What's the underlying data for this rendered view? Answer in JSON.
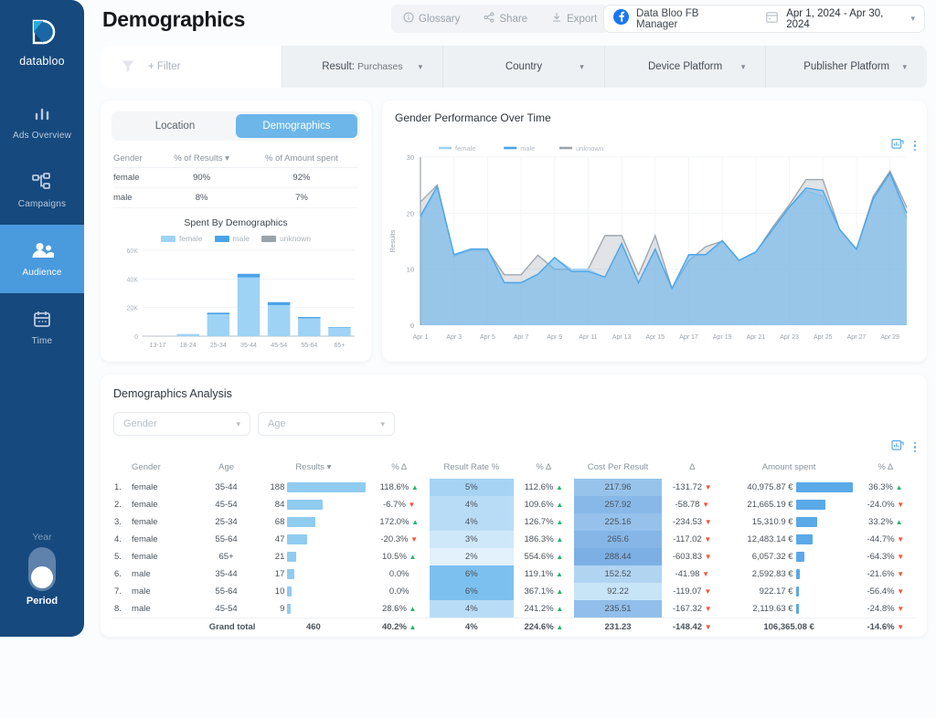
{
  "brand": {
    "name": "databloo",
    "sidebar_bg": "#16497d",
    "active_bg": "#4a9ade",
    "accent": "#5aa9e8"
  },
  "header": {
    "title": "Demographics",
    "tools": [
      {
        "label": "Glossary",
        "icon": "info-icon"
      },
      {
        "label": "Share",
        "icon": "share-icon"
      },
      {
        "label": "Export",
        "icon": "download-icon"
      }
    ],
    "account": "Data Bloo FB Manager",
    "account_icon": "facebook-icon",
    "date_range": "Apr 1, 2024 - Apr 30, 2024",
    "calendar_icon": "calendar-icon"
  },
  "filters": {
    "add_filter": "+ Filter",
    "filter_icon": "funnel-icon",
    "items": [
      {
        "label": "Result:",
        "value": "Purchases"
      },
      {
        "label": "Country",
        "value": ""
      },
      {
        "label": "Device Platform",
        "value": ""
      },
      {
        "label": "Publisher Platform",
        "value": ""
      }
    ]
  },
  "sidebar": {
    "items": [
      {
        "label": "Ads Overview",
        "icon": "bar-chart-icon",
        "active": false
      },
      {
        "label": "Campaigns",
        "icon": "sitemap-icon",
        "active": false
      },
      {
        "label": "Audience",
        "icon": "users-icon",
        "active": true
      },
      {
        "label": "Time",
        "icon": "calendar-icon",
        "active": false
      }
    ],
    "toggle": {
      "top_label": "Year",
      "bottom_label": "Period",
      "state": "Period"
    }
  },
  "left_card": {
    "tabs": [
      {
        "label": "Location",
        "active": false
      },
      {
        "label": "Demographics",
        "active": true
      }
    ],
    "gender_table": {
      "columns": [
        "Gender",
        "% of Results",
        "% of Amount spent"
      ],
      "sorted_column": "% of Results",
      "rows": [
        {
          "gender": "female",
          "pct_results": "90%",
          "pct_amount": "92%"
        },
        {
          "gender": "male",
          "pct_results": "8%",
          "pct_amount": "7%"
        }
      ]
    },
    "chart_title": "Spent By Demographics"
  },
  "right_card": {
    "title": "Gender Performance Over Time",
    "export_icon": "chart-export-icon",
    "menu_icon": "kebab-menu-icon"
  },
  "table_card": {
    "title": "Demographics Analysis",
    "selects": [
      {
        "placeholder": "Gender"
      },
      {
        "placeholder": "Age"
      }
    ],
    "export_icon": "chart-export-icon",
    "menu_icon": "kebab-menu-icon",
    "columns": [
      "Gender",
      "Age",
      "Results",
      "% Δ",
      "Result Rate %",
      "% Δ",
      "Cost Per Result",
      "Δ",
      "Amount spent",
      "% Δ"
    ],
    "sorted_column": "Results",
    "rows": [
      {
        "idx": "1.",
        "gender": "female",
        "age": "35-44",
        "results": "188",
        "results_val": 188,
        "d1": "118.6%",
        "d1_dir": "up",
        "rate": "5%",
        "rate_val": 5,
        "d2": "112.6%",
        "d2_dir": "up",
        "cpr": "217.96",
        "cpr_val": 217.96,
        "d3": "-131.72",
        "d3_dir": "down",
        "amount": "40,975.87 €",
        "amount_val": 40975.87,
        "d4": "36.3%",
        "d4_dir": "up"
      },
      {
        "idx": "2.",
        "gender": "female",
        "age": "45-54",
        "results": "84",
        "results_val": 84,
        "d1": "-6.7%",
        "d1_dir": "down",
        "rate": "4%",
        "rate_val": 4,
        "d2": "109.6%",
        "d2_dir": "up",
        "cpr": "257.92",
        "cpr_val": 257.92,
        "d3": "-58.78",
        "d3_dir": "down",
        "amount": "21,665.19 €",
        "amount_val": 21665.19,
        "d4": "-24.0%",
        "d4_dir": "down"
      },
      {
        "idx": "3.",
        "gender": "female",
        "age": "25-34",
        "results": "68",
        "results_val": 68,
        "d1": "172.0%",
        "d1_dir": "up",
        "rate": "4%",
        "rate_val": 4,
        "d2": "126.7%",
        "d2_dir": "up",
        "cpr": "225.16",
        "cpr_val": 225.16,
        "d3": "-234.53",
        "d3_dir": "down",
        "amount": "15,310.9 €",
        "amount_val": 15310.9,
        "d4": "33.2%",
        "d4_dir": "up"
      },
      {
        "idx": "4.",
        "gender": "female",
        "age": "55-64",
        "results": "47",
        "results_val": 47,
        "d1": "-20.3%",
        "d1_dir": "down",
        "rate": "3%",
        "rate_val": 3,
        "d2": "186.3%",
        "d2_dir": "up",
        "cpr": "265.6",
        "cpr_val": 265.6,
        "d3": "-117.02",
        "d3_dir": "down",
        "amount": "12,483.14 €",
        "amount_val": 12483.14,
        "d4": "-44.7%",
        "d4_dir": "down"
      },
      {
        "idx": "5.",
        "gender": "female",
        "age": "65+",
        "results": "21",
        "results_val": 21,
        "d1": "10.5%",
        "d1_dir": "up",
        "rate": "2%",
        "rate_val": 2,
        "d2": "554.6%",
        "d2_dir": "up",
        "cpr": "288.44",
        "cpr_val": 288.44,
        "d3": "-603.83",
        "d3_dir": "down",
        "amount": "6,057.32 €",
        "amount_val": 6057.32,
        "d4": "-64.3%",
        "d4_dir": "down"
      },
      {
        "idx": "6.",
        "gender": "male",
        "age": "35-44",
        "results": "17",
        "results_val": 17,
        "d1": "0.0%",
        "d1_dir": "none",
        "rate": "6%",
        "rate_val": 6,
        "d2": "119.1%",
        "d2_dir": "up",
        "cpr": "152.52",
        "cpr_val": 152.52,
        "d3": "-41.98",
        "d3_dir": "down",
        "amount": "2,592.83 €",
        "amount_val": 2592.83,
        "d4": "-21.6%",
        "d4_dir": "down"
      },
      {
        "idx": "7.",
        "gender": "male",
        "age": "55-64",
        "results": "10",
        "results_val": 10,
        "d1": "0.0%",
        "d1_dir": "none",
        "rate": "6%",
        "rate_val": 6,
        "d2": "367.1%",
        "d2_dir": "up",
        "cpr": "92.22",
        "cpr_val": 92.22,
        "d3": "-119.07",
        "d3_dir": "down",
        "amount": "922.17 €",
        "amount_val": 922.17,
        "d4": "-56.4%",
        "d4_dir": "down"
      },
      {
        "idx": "8.",
        "gender": "male",
        "age": "45-54",
        "results": "9",
        "results_val": 9,
        "d1": "28.6%",
        "d1_dir": "up",
        "rate": "4%",
        "rate_val": 4,
        "d2": "241.2%",
        "d2_dir": "up",
        "cpr": "235.51",
        "cpr_val": 235.51,
        "d3": "-167.32",
        "d3_dir": "down",
        "amount": "2,119.63 €",
        "amount_val": 2119.63,
        "d4": "-24.8%",
        "d4_dir": "down"
      }
    ],
    "total": {
      "label": "Grand total",
      "results": "460",
      "d1": "40.2%",
      "d1_dir": "up",
      "rate": "4%",
      "d2": "224.6%",
      "d2_dir": "up",
      "cpr": "231.23",
      "d3": "-148.42",
      "d3_dir": "down",
      "amount": "106,365.08 €",
      "d4": "-14.6%",
      "d4_dir": "down"
    }
  },
  "chart_data": [
    {
      "type": "bar",
      "title": "Spent By Demographics",
      "stacked": true,
      "categories": [
        "13-17",
        "18-24",
        "25-34",
        "35-44",
        "45-54",
        "55-64",
        "65+"
      ],
      "series": [
        {
          "name": "female",
          "color": "#9ed3f5",
          "values": [
            0,
            1200,
            15300,
            40976,
            21665,
            12483,
            6057
          ]
        },
        {
          "name": "male",
          "color": "#4aa3e8",
          "values": [
            0,
            200,
            1100,
            2593,
            2120,
            900,
            300
          ]
        },
        {
          "name": "unknown",
          "color": "#9ba3ab",
          "values": [
            0,
            0,
            0,
            0,
            0,
            0,
            0
          ]
        }
      ],
      "ylabel": "",
      "xlabel": "",
      "yticks": [
        "0",
        "20K",
        "40K",
        "60K"
      ],
      "ylim": [
        0,
        60000
      ],
      "legend_position": "top",
      "grid": true
    },
    {
      "type": "area",
      "title": "Gender Performance Over Time",
      "ylabel": "Results",
      "xlabel": "",
      "ylim": [
        0,
        30
      ],
      "yticks": [
        "0",
        "10",
        "20",
        "30"
      ],
      "grid": true,
      "legend_position": "top-left",
      "x": [
        "Apr 1",
        "Apr 2",
        "Apr 3",
        "Apr 4",
        "Apr 5",
        "Apr 6",
        "Apr 7",
        "Apr 8",
        "Apr 9",
        "Apr 10",
        "Apr 11",
        "Apr 12",
        "Apr 13",
        "Apr 14",
        "Apr 15",
        "Apr 16",
        "Apr 17",
        "Apr 18",
        "Apr 19",
        "Apr 20",
        "Apr 21",
        "Apr 22",
        "Apr 23",
        "Apr 24",
        "Apr 25",
        "Apr 26",
        "Apr 27",
        "Apr 28",
        "Apr 29",
        "Apr 30"
      ],
      "xtick_labels": [
        "Apr 1",
        "Apr 3",
        "Apr 5",
        "Apr 7",
        "Apr 9",
        "Apr 11",
        "Apr 13",
        "Apr 15",
        "Apr 17",
        "Apr 19",
        "Apr 21",
        "Apr 23",
        "Apr 25",
        "Apr 27",
        "Apr 29"
      ],
      "series": [
        {
          "name": "female",
          "color": "#9ed3f5",
          "values": [
            19,
            24.5,
            12.5,
            13.5,
            13.5,
            7.5,
            7.5,
            9,
            12,
            10,
            10,
            8.5,
            14.5,
            7.5,
            13.5,
            6.5,
            12.5,
            12.5,
            15,
            11.5,
            13,
            17,
            21,
            24,
            23,
            17,
            13.5,
            22.5,
            27,
            19
          ]
        },
        {
          "name": "male",
          "color": "#4aa3e8",
          "values": [
            19.5,
            24.8,
            12.6,
            13.6,
            13.6,
            7.6,
            7.6,
            9.1,
            12.1,
            9.6,
            9.6,
            8.6,
            14.6,
            7.6,
            13.6,
            6.6,
            12.6,
            12.6,
            15.1,
            11.6,
            13.1,
            17.1,
            21.1,
            24.5,
            24,
            17.1,
            13.6,
            22.6,
            27.2,
            20
          ]
        },
        {
          "name": "unknown",
          "color": "#9ba3ab",
          "values": [
            22,
            25,
            12.4,
            13.4,
            13.4,
            9,
            9,
            12.5,
            10,
            10,
            10,
            16,
            16,
            9,
            16,
            6.5,
            11.5,
            14,
            15,
            11.5,
            13,
            17.5,
            21.5,
            26,
            26,
            17,
            13.5,
            23,
            27.5,
            21
          ]
        }
      ]
    }
  ]
}
